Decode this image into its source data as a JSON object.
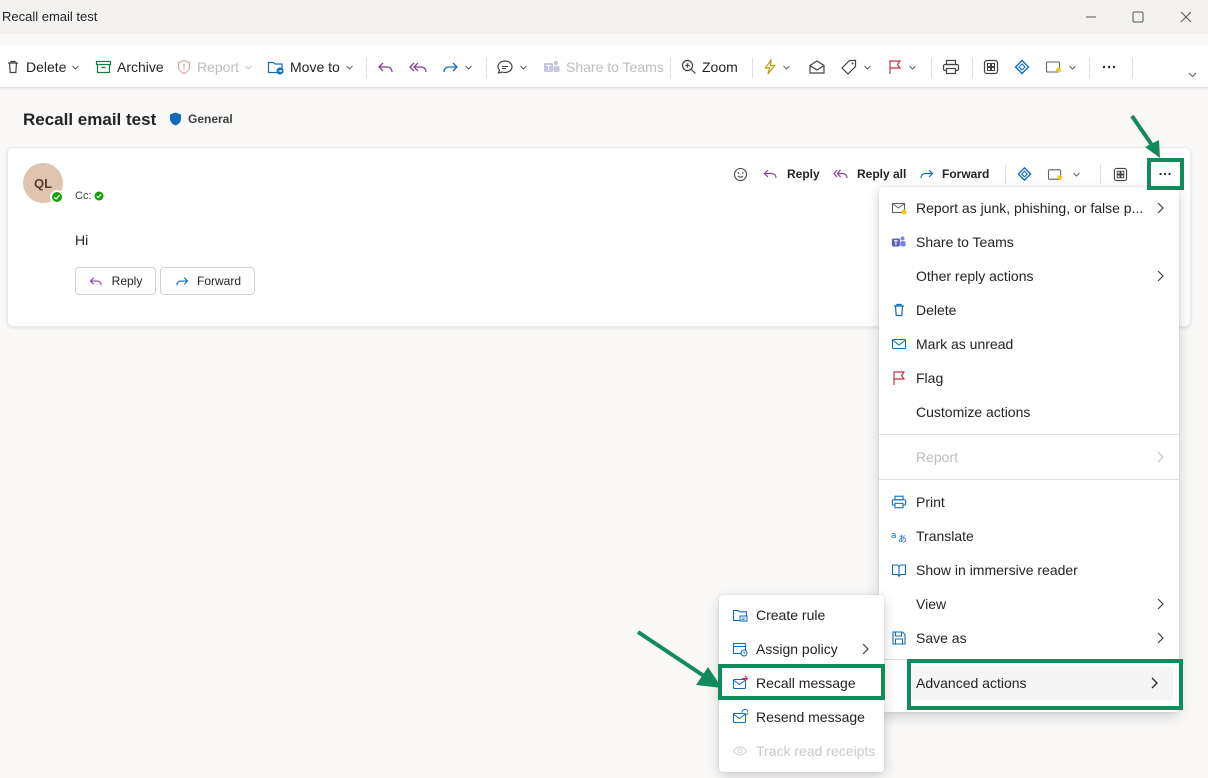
{
  "window": {
    "title": "Recall email test"
  },
  "toolbar": {
    "delete": "Delete",
    "archive": "Archive",
    "report": "Report",
    "move_to": "Move to",
    "share_to_teams": "Share to Teams",
    "zoom": "Zoom"
  },
  "message": {
    "subject": "Recall email test",
    "sensitivity_label": "General",
    "avatar_initials": "QL",
    "cc_label": "Cc:",
    "body": "Hi",
    "reply": "Reply",
    "reply_all": "Reply all",
    "forward": "Forward"
  },
  "more_menu": {
    "items": [
      {
        "label": "Report as junk, phishing, or false p...",
        "icon": "junk-report-icon",
        "submenu": true
      },
      {
        "label": "Share to Teams",
        "icon": "teams-icon",
        "submenu": false
      },
      {
        "label": "Other reply actions",
        "icon": "",
        "submenu": true
      },
      {
        "label": "Delete",
        "icon": "trash-icon",
        "submenu": false
      },
      {
        "label": "Mark as unread",
        "icon": "envelope-icon",
        "submenu": false
      },
      {
        "label": "Flag",
        "icon": "flag-icon",
        "submenu": false
      },
      {
        "label": "Customize actions",
        "icon": "",
        "submenu": false
      },
      {
        "label": "Report",
        "icon": "",
        "submenu": true,
        "disabled": true
      },
      {
        "label": "Print",
        "icon": "printer-icon",
        "submenu": false
      },
      {
        "label": "Translate",
        "icon": "translate-icon",
        "submenu": false
      },
      {
        "label": "Show in immersive reader",
        "icon": "immersive-reader-icon",
        "submenu": false
      },
      {
        "label": "View",
        "icon": "",
        "submenu": true
      },
      {
        "label": "Save as",
        "icon": "save-icon",
        "submenu": true
      },
      {
        "label": "Advanced actions",
        "icon": "",
        "submenu": true
      }
    ]
  },
  "advanced_menu": {
    "items": [
      {
        "label": "Create rule",
        "icon": "create-rule-icon",
        "submenu": false
      },
      {
        "label": "Assign policy",
        "icon": "assign-policy-icon",
        "submenu": true
      },
      {
        "label": "Recall message",
        "icon": "recall-message-icon",
        "submenu": false
      },
      {
        "label": "Resend message",
        "icon": "resend-message-icon",
        "submenu": false
      },
      {
        "label": "Track read receipts",
        "icon": "read-receipt-icon",
        "submenu": false,
        "disabled": true
      }
    ]
  },
  "colors": {
    "annotation_green": "#138a5c",
    "accent_blue": "#0f6cbd",
    "reply_purple": "#8a3f9e",
    "flag_red": "#c4314b"
  }
}
